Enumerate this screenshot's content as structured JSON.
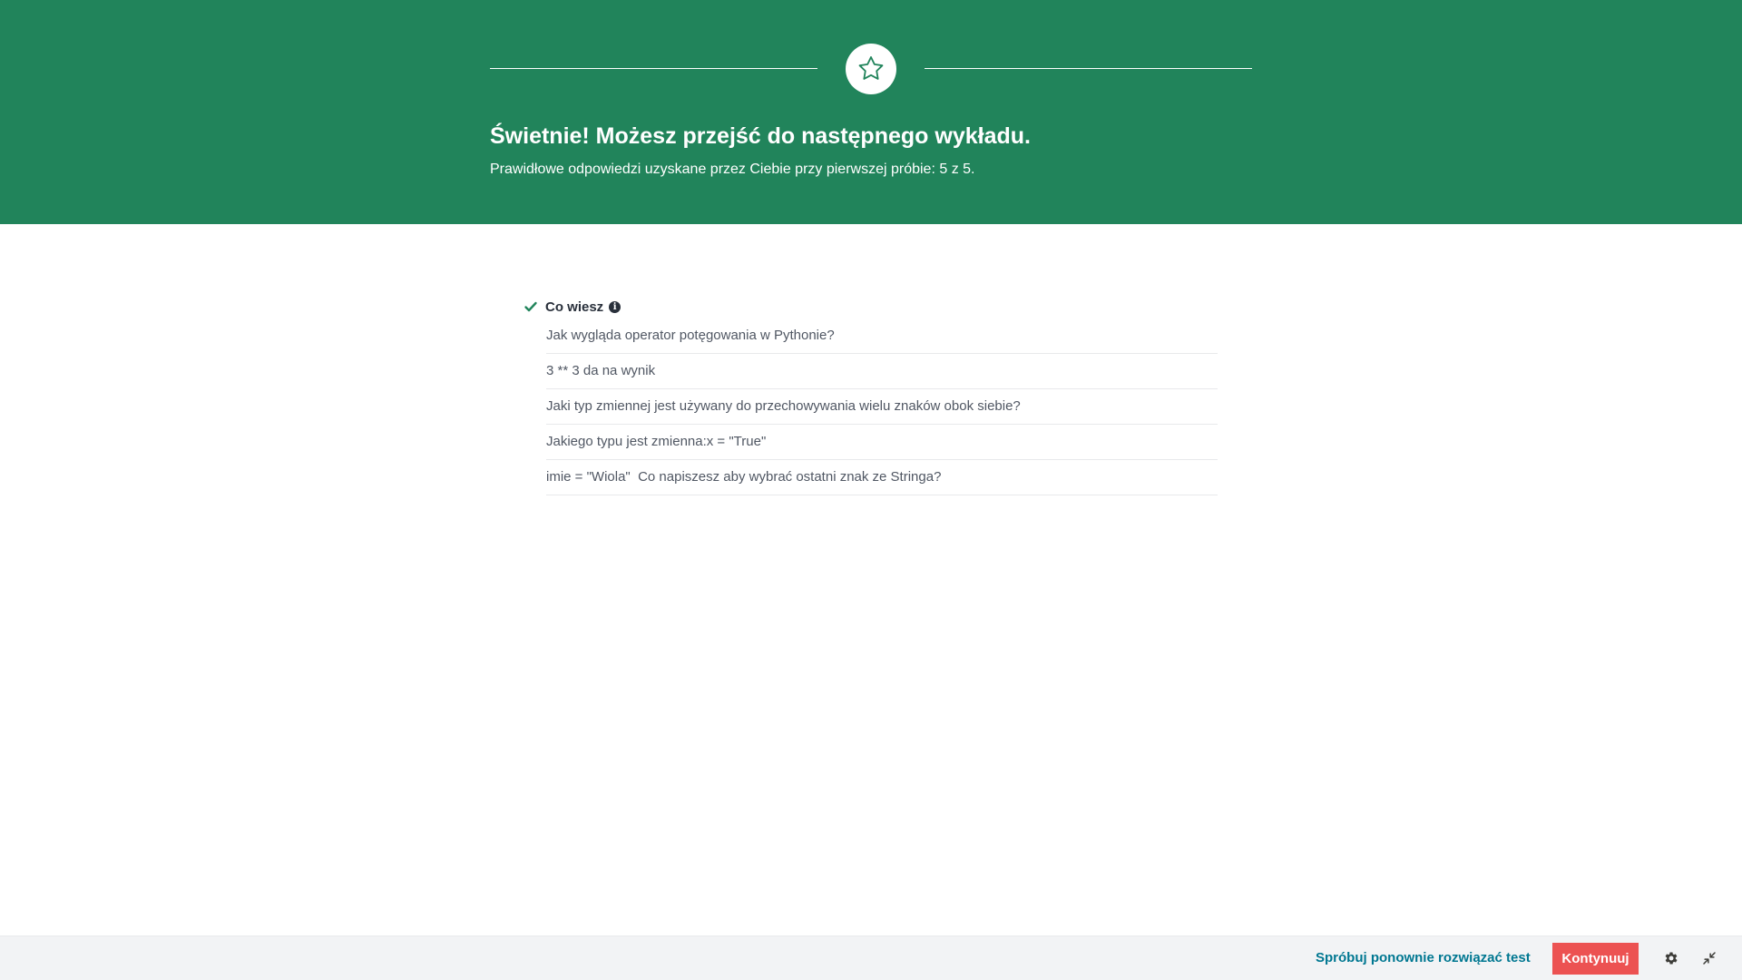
{
  "banner": {
    "background_color": "#21845b",
    "icon": "star-icon",
    "title": "Świetnie! Możesz przejść do następnego wykładu.",
    "subtitle": "Prawidłowe odpowiedzi uzyskane przez Ciebie przy pierwszej próbie: 5 z 5."
  },
  "results": {
    "section_icon": "check-icon",
    "section_title": "Co wiesz",
    "info_icon": "info-icon",
    "questions": [
      "Jak wygląda operator potęgowania w Pythonie?",
      "3 ** 3 da na wynik",
      "Jaki typ zmiennej jest używany do przechowywania wielu znaków obok siebie?",
      "Jakiego typu jest zmienna:x = \"True\"",
      "imie = \"Wiola\"  Co napiszesz aby wybrać ostatni znak ze Stringa?"
    ]
  },
  "footer": {
    "retry_label": "Spróbuj ponownie rozwiązać test",
    "continue_label": "Kontynuuj",
    "settings_icon": "gear-icon",
    "collapse_icon": "collapse-icon",
    "accent_color": "#ec5252",
    "link_color": "#007791"
  }
}
